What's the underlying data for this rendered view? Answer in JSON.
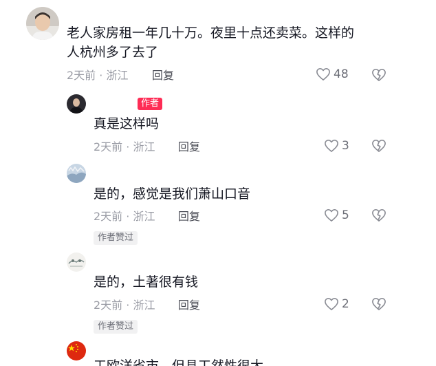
{
  "comments": [
    {
      "text_line1": "老人家房租一年几十万。夜里十点还卖菜。这样的",
      "text_line2": "人杭州多了去了",
      "meta": "2天前 · 浙江",
      "reply_label": "回复",
      "likes": "48"
    }
  ],
  "replies": [
    {
      "badge": "作者",
      "text": "真是这样吗",
      "meta": "2天前 · 浙江",
      "reply_label": "回复",
      "likes": "3"
    },
    {
      "text": "是的，感觉是我们萧山口音",
      "meta": "2天前 · 浙江",
      "reply_label": "回复",
      "likes": "5",
      "liked_badge": "作者赞过"
    },
    {
      "text": "是的，土著很有钱",
      "meta": "2天前 · 浙江",
      "reply_label": "回复",
      "likes": "2",
      "liked_badge": "作者赞过"
    },
    {
      "text_partial": "工欧洋省市，但县工然性很大"
    }
  ],
  "icons": {
    "like": "heart-outline-icon",
    "dislike": "broken-heart-icon"
  },
  "colors": {
    "accent": "#fe2c55",
    "meta_gray": "#9a9ca5",
    "text": "#161823"
  }
}
